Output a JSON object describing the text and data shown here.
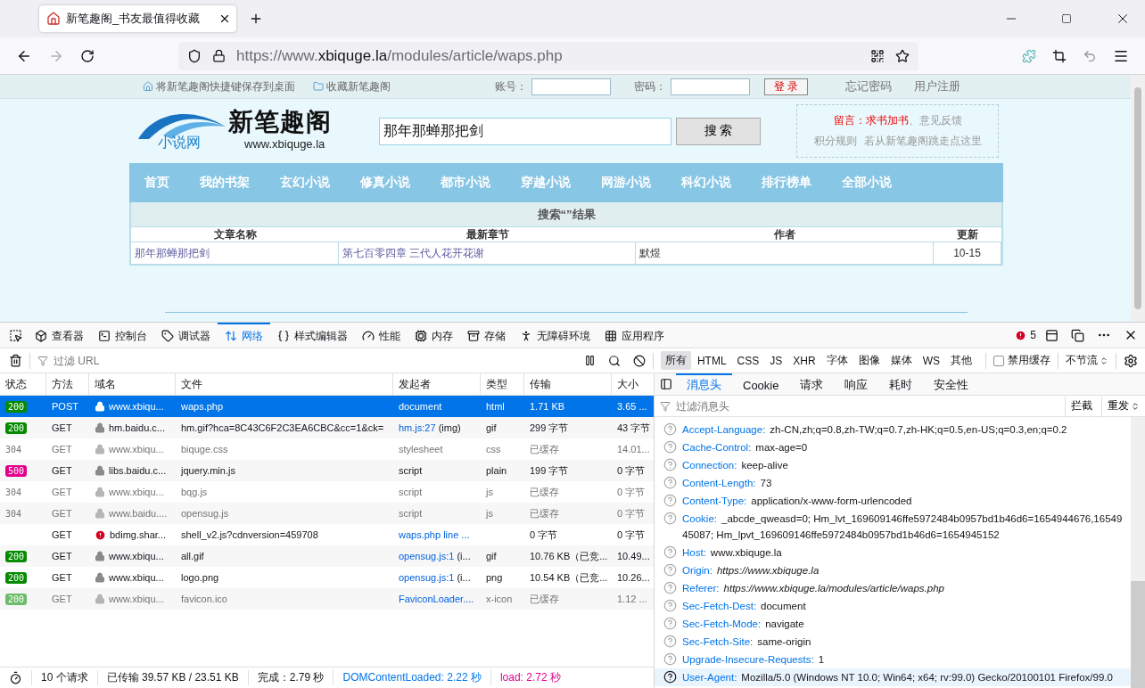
{
  "browser": {
    "tab_title": "新笔趣阁_书友最值得收藏",
    "back_enabled": true,
    "forward_enabled": false,
    "url": {
      "scheme": "https://www.",
      "host": "xbiquge.la",
      "path": "/modules/article/waps.php"
    }
  },
  "page": {
    "top_links": [
      "将新笔趣阁快捷键保存到桌面",
      "收藏新笔趣阁"
    ],
    "account_label": "账号：",
    "password_label": "密码：",
    "login_button": "登 录",
    "user_links": [
      "忘记密码",
      "用户注册"
    ],
    "logo": {
      "title": "新笔趣阁",
      "badge": "小说网",
      "url": "www.xbiquge.la"
    },
    "search": {
      "value": "那年那蝉那把剑",
      "button": "搜 索"
    },
    "notice": {
      "label": "留言：",
      "request_link": "求书加书",
      "separator": "、",
      "feedback_link": "意见反馈",
      "rules_link": "积分规则",
      "jump_link": "若从新笔趣阁跳走点这里"
    },
    "nav": [
      "首页",
      "我的书架",
      "玄幻小说",
      "修真小说",
      "都市小说",
      "穿越小说",
      "网游小说",
      "科幻小说",
      "排行榜单",
      "全部小说"
    ],
    "results": {
      "title": "搜索“”结果",
      "columns": [
        "文章名称",
        "最新章节",
        "作者",
        "更新"
      ],
      "rows": [
        [
          "那年那蝉那把剑",
          "第七百零四章 三代人花开花谢",
          "默煜",
          "10-15"
        ]
      ]
    }
  },
  "devtools": {
    "tools": [
      {
        "label": "查看器",
        "selected": false
      },
      {
        "label": "控制台",
        "selected": false
      },
      {
        "label": "调试器",
        "selected": false
      },
      {
        "label": "网络",
        "selected": true
      },
      {
        "label": "样式编辑器",
        "selected": false
      },
      {
        "label": "性能",
        "selected": false
      },
      {
        "label": "内存",
        "selected": false
      },
      {
        "label": "存储",
        "selected": false
      },
      {
        "label": "无障碍环境",
        "selected": false
      },
      {
        "label": "应用程序",
        "selected": false
      }
    ],
    "error_count": "5",
    "filter_placeholder": "过滤 URL",
    "type_filters": [
      {
        "label": "所有",
        "selected": true
      },
      {
        "label": "HTML",
        "selected": false
      },
      {
        "label": "CSS",
        "selected": false
      },
      {
        "label": "JS",
        "selected": false
      },
      {
        "label": "XHR",
        "selected": false
      },
      {
        "label": "字体",
        "selected": false
      },
      {
        "label": "图像",
        "selected": false
      },
      {
        "label": "媒体",
        "selected": false
      },
      {
        "label": "WS",
        "selected": false
      },
      {
        "label": "其他",
        "selected": false
      }
    ],
    "disable_cache": {
      "label": "禁用缓存",
      "checked": false
    },
    "throttle": "不节流",
    "columns": [
      "状态",
      "方法",
      "域名",
      "文件",
      "发起者",
      "类型",
      "传输",
      "大小"
    ],
    "requests": [
      {
        "status": {
          "text": "200",
          "kind": "ok"
        },
        "method": "POST",
        "kind": "secure",
        "domain": "www.xbiqu...",
        "file": "waps.php",
        "initiator": "document",
        "type": "html",
        "transferred": "1.71 KB",
        "size": "3.65 ...",
        "selected": true,
        "dimmed": false
      },
      {
        "status": {
          "text": "200",
          "kind": "ok"
        },
        "method": "GET",
        "kind": "secure",
        "domain": "hm.baidu.c...",
        "file": "hm.gif?hca=8C43C6F2C3EA6CBC&cc=1&ck=",
        "initiator_link": "hm.js:27",
        "initiator": " (img)",
        "type": "gif",
        "transferred": "299 字节",
        "size": "43 字节",
        "selected": false,
        "dimmed": false
      },
      {
        "status": {
          "text": "304",
          "kind": "cached"
        },
        "method": "GET",
        "kind": "secure",
        "domain": "www.xbiqu...",
        "file": "biquge.css",
        "initiator": "stylesheet",
        "type": "css",
        "transferred": "已缓存",
        "size": "14.01...",
        "selected": false,
        "dimmed": true
      },
      {
        "status": {
          "text": "500",
          "kind": "error"
        },
        "method": "GET",
        "kind": "secure",
        "domain": "libs.baidu.c...",
        "file": "jquery.min.js",
        "initiator": "script",
        "type": "plain",
        "transferred": "199 字节",
        "size": "0 字节",
        "selected": false,
        "dimmed": false
      },
      {
        "status": {
          "text": "304",
          "kind": "cached"
        },
        "method": "GET",
        "kind": "secure",
        "domain": "www.xbiqu...",
        "file": "bqg.js",
        "initiator": "script",
        "type": "js",
        "transferred": "已缓存",
        "size": "0 字节",
        "selected": false,
        "dimmed": true
      },
      {
        "status": {
          "text": "304",
          "kind": "cached"
        },
        "method": "GET",
        "kind": "secure",
        "domain": "www.baidu....",
        "file": "opensug.js",
        "initiator": "script",
        "type": "js",
        "transferred": "已缓存",
        "size": "0 字节",
        "selected": false,
        "dimmed": true
      },
      {
        "method": "GET",
        "kind": "failed",
        "domain": "bdimg.shar...",
        "file": "shell_v2.js?cdnversion=459708",
        "initiator_link": "waps.php line ...",
        "transferred": "0 字节",
        "size": "0 字节",
        "selected": false,
        "dimmed": false
      },
      {
        "status": {
          "text": "200",
          "kind": "ok"
        },
        "method": "GET",
        "kind": "secure",
        "domain": "www.xbiqu...",
        "file": "all.gif",
        "initiator_link": "opensug.js:1",
        "initiator": " (i...",
        "type": "gif",
        "transferred": "10.76 KB（已竞...",
        "size": "10.49...",
        "selected": false,
        "dimmed": false
      },
      {
        "status": {
          "text": "200",
          "kind": "ok"
        },
        "method": "GET",
        "kind": "secure",
        "domain": "www.xbiqu...",
        "file": "logo.png",
        "initiator_link": "opensug.js:1",
        "initiator": " (i...",
        "type": "png",
        "transferred": "10.54 KB（已竞...",
        "size": "10.26...",
        "selected": false,
        "dimmed": false
      },
      {
        "status": {
          "text": "200",
          "kind": "ok"
        },
        "method": "GET",
        "kind": "secure",
        "domain": "www.xbiqu...",
        "file": "favicon.ico",
        "initiator_link": "FaviconLoader....",
        "type": "x-icon",
        "transferred": "已缓存",
        "size": "1.12 ...",
        "selected": false,
        "dimmed": true
      }
    ],
    "summary": [
      {
        "text": "10 个请求",
        "kind": "plain"
      },
      {
        "text": "已传输 39.57 KB / 23.51 KB",
        "kind": "plain"
      },
      {
        "text": "完成：2.79 秒",
        "kind": "plain"
      },
      {
        "text": "DOMContentLoaded: 2.22 秒",
        "kind": "dom"
      },
      {
        "text": "load: 2.72 秒",
        "kind": "load"
      }
    ],
    "panel_tabs": [
      {
        "label": "消息头",
        "selected": true
      },
      {
        "label": "Cookie",
        "selected": false
      },
      {
        "label": "请求",
        "selected": false
      },
      {
        "label": "响应",
        "selected": false
      },
      {
        "label": "耗时",
        "selected": false
      },
      {
        "label": "安全性",
        "selected": false
      }
    ],
    "header_filter_placeholder": "过滤消息头",
    "block_button": "拦截",
    "resend_button": "重发",
    "headers": [
      {
        "name": "Accept-Language:",
        "value": "zh-CN,zh;q=0.8,zh-TW;q=0.7,zh-HK;q=0.5,en-US;q=0.3,en;q=0.2",
        "italic": false,
        "highlighted": false
      },
      {
        "name": "Cache-Control:",
        "value": "max-age=0",
        "italic": false,
        "highlighted": false
      },
      {
        "name": "Connection:",
        "value": "keep-alive",
        "italic": false,
        "highlighted": false
      },
      {
        "name": "Content-Length:",
        "value": "73",
        "italic": false,
        "highlighted": false
      },
      {
        "name": "Content-Type:",
        "value": "application/x-www-form-urlencoded",
        "italic": false,
        "highlighted": false
      },
      {
        "name": "Cookie:",
        "value": "_abcde_qweasd=0; Hm_lvt_169609146ffe5972484b0957bd1b46d6=1654944676,1654945087; Hm_lpvt_169609146ffe5972484b0957bd1b46d6=1654945152",
        "italic": false,
        "highlighted": false
      },
      {
        "name": "Host:",
        "value": "www.xbiquge.la",
        "italic": false,
        "highlighted": false
      },
      {
        "name": "Origin:",
        "value": "https://www.xbiquge.la",
        "italic": true,
        "highlighted": false
      },
      {
        "name": "Referer:",
        "value": "https://www.xbiquge.la/modules/article/waps.php",
        "italic": true,
        "highlighted": false
      },
      {
        "name": "Sec-Fetch-Dest:",
        "value": "document",
        "italic": false,
        "highlighted": false
      },
      {
        "name": "Sec-Fetch-Mode:",
        "value": "navigate",
        "italic": false,
        "highlighted": false
      },
      {
        "name": "Sec-Fetch-Site:",
        "value": "same-origin",
        "italic": false,
        "highlighted": false
      },
      {
        "name": "Upgrade-Insecure-Requests:",
        "value": "1",
        "italic": false,
        "highlighted": false
      },
      {
        "name": "User-Agent:",
        "value": "Mozilla/5.0 (Windows NT 10.0; Win64; x64; rv:99.0) Gecko/20100101 Firefox/99.0",
        "italic": false,
        "highlighted": true
      }
    ]
  }
}
